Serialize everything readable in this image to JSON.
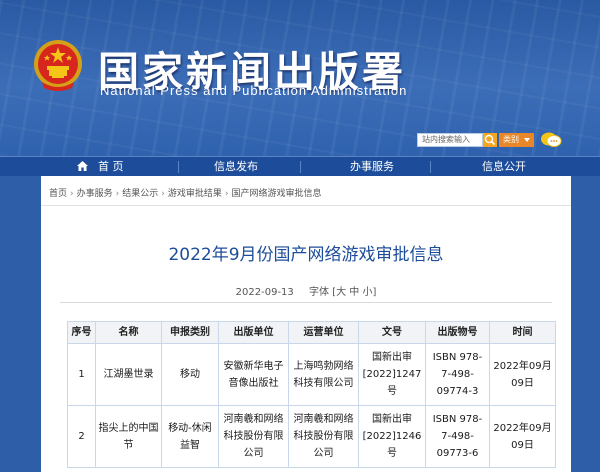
{
  "header": {
    "title": "国家新闻出版署",
    "subtitle": "National Press and Publication Administration",
    "emblem_icon": "national-emblem-icon"
  },
  "search": {
    "value": "站内搜索输入",
    "category": "类别",
    "button_icon": "search-icon",
    "chat_icon": "chat-bubble-icon"
  },
  "nav": {
    "items": [
      {
        "label": "首 页",
        "icon": "home-icon"
      },
      {
        "label": "信息发布"
      },
      {
        "label": "办事服务"
      },
      {
        "label": "信息公开"
      }
    ]
  },
  "breadcrumb": [
    "首页",
    "办事服务",
    "结果公示",
    "游戏审批结果",
    "国产网络游戏审批信息"
  ],
  "breadcrumb_separator": "›",
  "article": {
    "title": "2022年9月份国产网络游戏审批信息",
    "date": "2022-09-13",
    "font_size_label": "字体",
    "font_size_options": [
      "大",
      "中",
      "小"
    ]
  },
  "table": {
    "headers": [
      "序号",
      "名称",
      "申报类别",
      "出版单位",
      "运营单位",
      "文号",
      "出版物号",
      "时间"
    ],
    "rows": [
      {
        "cells": [
          "1",
          "江湖墨世录",
          "移动",
          "安徽新华电子音像出版社",
          "上海鸣勃网络科技有限公司",
          "国新出审[2022]1247号",
          "ISBN 978-7-498-09774-3",
          "2022年09月09日"
        ],
        "lines": [
          [
            "1"
          ],
          [
            "江湖墨世录"
          ],
          [
            "移动"
          ],
          [
            "安徽新华电子",
            "音像出版社"
          ],
          [
            "上海鸣勃网络",
            "科技有限公司"
          ],
          [
            "国新出审",
            "[2022]1247号"
          ],
          [
            "ISBN 978-",
            "7-498-",
            "09774-3"
          ],
          [
            "2022年09月",
            "09日"
          ]
        ]
      },
      {
        "cells": [
          "2",
          "指尖上的中国节",
          "移动-休闲益智",
          "河南羲和网络科技股份有限公司",
          "河南羲和网络科技股份有限公司",
          "国新出审[2022]1246号",
          "ISBN 978-7-498-09773-6",
          "2022年09月09日"
        ],
        "lines": [
          [
            "2"
          ],
          [
            "指尖上的中国",
            "节"
          ],
          [
            "移动-休闲",
            "益智"
          ],
          [
            "河南羲和网络",
            "科技股份有限",
            "公司"
          ],
          [
            "河南羲和网络",
            "科技股份有限",
            "公司"
          ],
          [
            "国新出审",
            "[2022]1246号"
          ],
          [
            "ISBN 978-",
            "7-498-",
            "09773-6"
          ],
          [
            "2022年09月",
            "09日"
          ]
        ]
      }
    ]
  },
  "colors": {
    "header_bg": "#2f62ae",
    "nav_bg": "#1d4d9a",
    "title_blue": "#1d4d9a",
    "search_button": "#f4a623",
    "category_button": "#e7872a"
  }
}
